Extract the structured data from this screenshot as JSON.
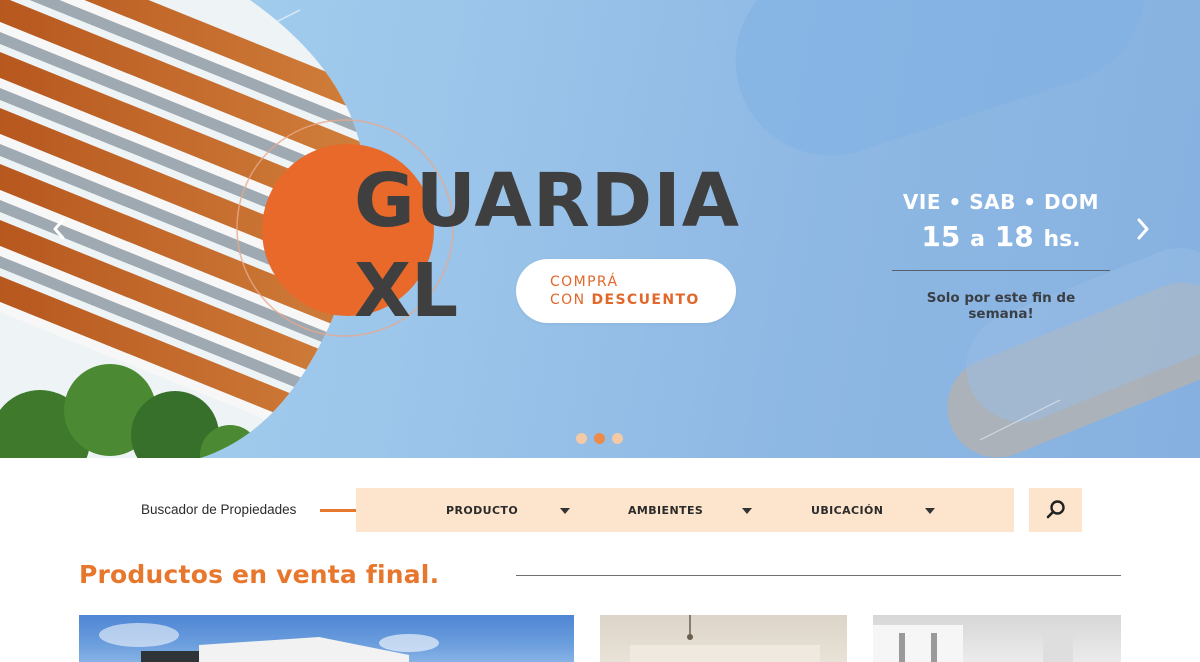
{
  "hero": {
    "title_line1": "GUARDIA",
    "title_line2": "XL",
    "cta_line1": "COMPRÁ",
    "cta_line2_prefix": "CON",
    "cta_line2_bold": "DESCUENTO",
    "days": "VIE • SAB • DOM",
    "hours_start": "15",
    "hours_connector": "a",
    "hours_end": "18",
    "hours_suffix": "hs.",
    "weekend_note": "Solo por este fin de semana!",
    "slides_total": 3,
    "active_slide": 2,
    "colors": {
      "accent": "#e8772e",
      "title": "#3f3f3f",
      "sky": "#9cc6ea"
    },
    "icons": {
      "prev": "chevron-left-icon",
      "next": "chevron-right-icon"
    }
  },
  "search": {
    "label": "Buscador de Propiedades",
    "filters": [
      {
        "label": "PRODUCTO"
      },
      {
        "label": "AMBIENTES"
      },
      {
        "label": "UBICACIÓN"
      }
    ],
    "button_icon": "search-icon",
    "bg_color": "#fde4cc"
  },
  "products": {
    "title": "Productos en venta final."
  }
}
